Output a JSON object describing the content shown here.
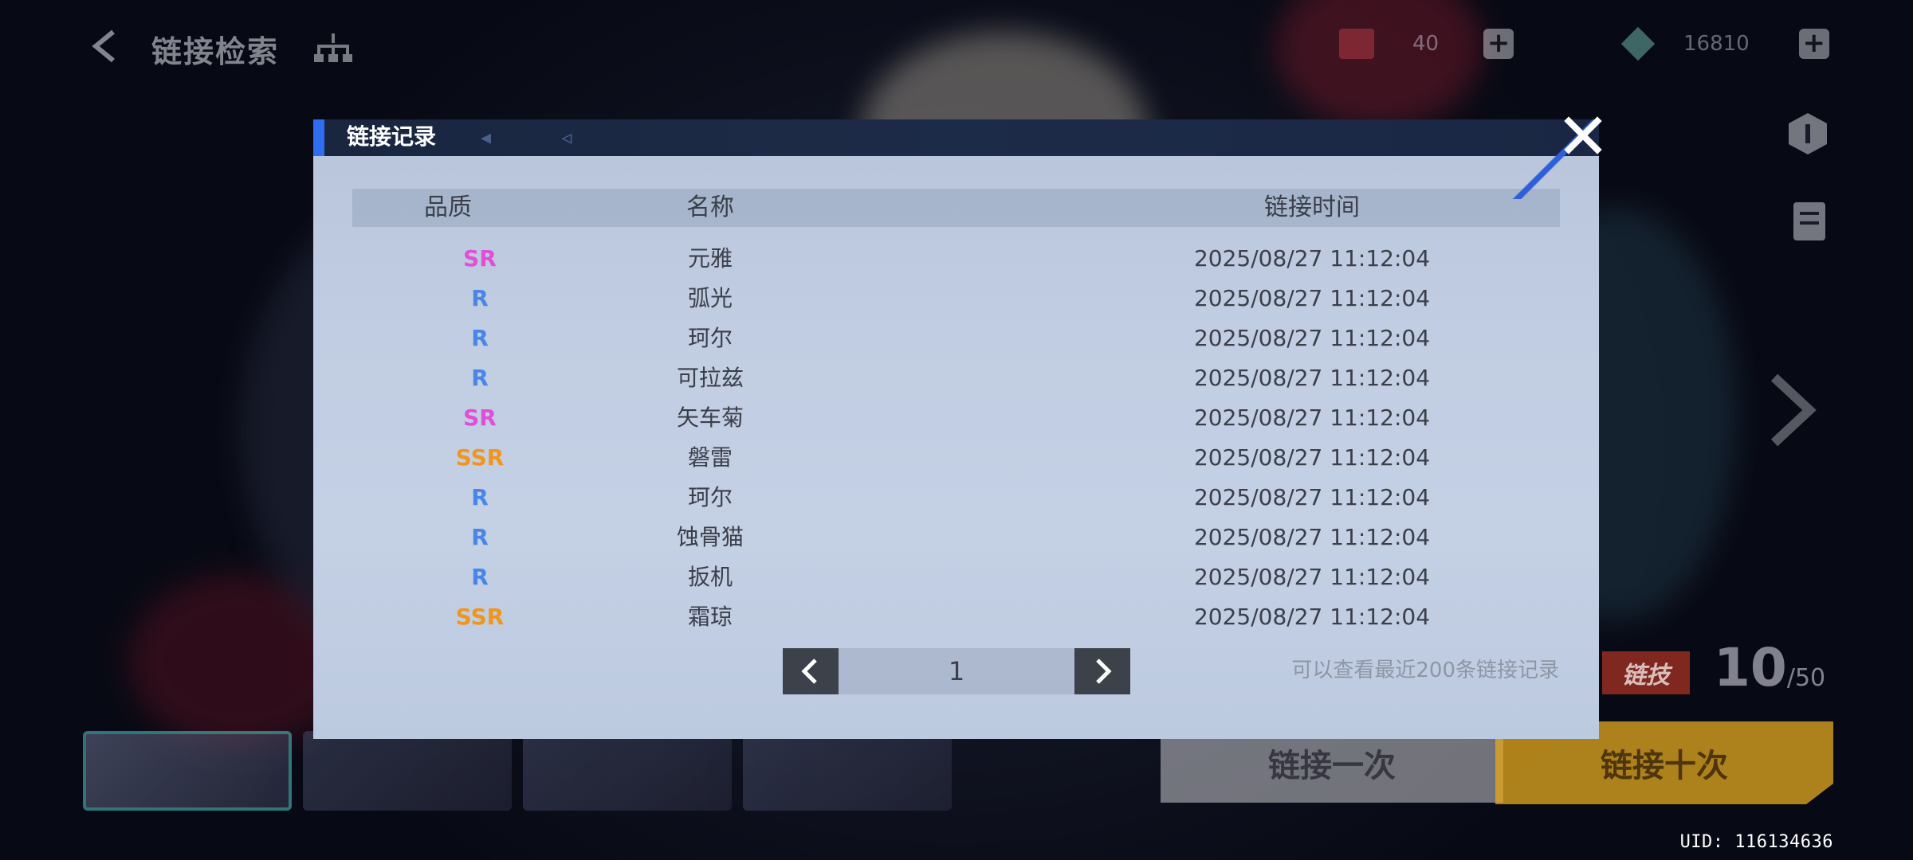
{
  "topbar": {
    "title": "链接检索",
    "currency_a": "40",
    "currency_b": "16810"
  },
  "modal": {
    "title": "链接记录",
    "columns": {
      "quality": "品质",
      "name": "名称",
      "time": "链接时间"
    },
    "rows": [
      {
        "quality": "SR",
        "name": "元雅",
        "time": "2025/08/27 11:12:04"
      },
      {
        "quality": "R",
        "name": "弧光",
        "time": "2025/08/27 11:12:04"
      },
      {
        "quality": "R",
        "name": "珂尔",
        "time": "2025/08/27 11:12:04"
      },
      {
        "quality": "R",
        "name": "可拉兹",
        "time": "2025/08/27 11:12:04"
      },
      {
        "quality": "SR",
        "name": "矢车菊",
        "time": "2025/08/27 11:12:04"
      },
      {
        "quality": "SSR",
        "name": "磐雷",
        "time": "2025/08/27 11:12:04"
      },
      {
        "quality": "R",
        "name": "珂尔",
        "time": "2025/08/27 11:12:04"
      },
      {
        "quality": "R",
        "name": "蚀骨猫",
        "time": "2025/08/27 11:12:04"
      },
      {
        "quality": "R",
        "name": "扳机",
        "time": "2025/08/27 11:12:04"
      },
      {
        "quality": "SSR",
        "name": "霜琼",
        "time": "2025/08/27 11:12:04"
      }
    ],
    "page": "1",
    "note": "可以查看最近200条链接记录"
  },
  "quality_colors": {
    "SSR": "#f0961e",
    "SR": "#e04fd8",
    "R": "#4a86e8"
  },
  "pull": {
    "once_label": "链接一次",
    "ten_label": "链接十次",
    "ticket_tag": "链技",
    "ticket_count": "10",
    "ticket_max": "/50"
  },
  "uid": "UID: 116134636",
  "icons": [
    "back-arrow-icon",
    "tree-icon",
    "plus-icon",
    "close-icon",
    "chevron-left-icon",
    "chevron-right-icon"
  ]
}
